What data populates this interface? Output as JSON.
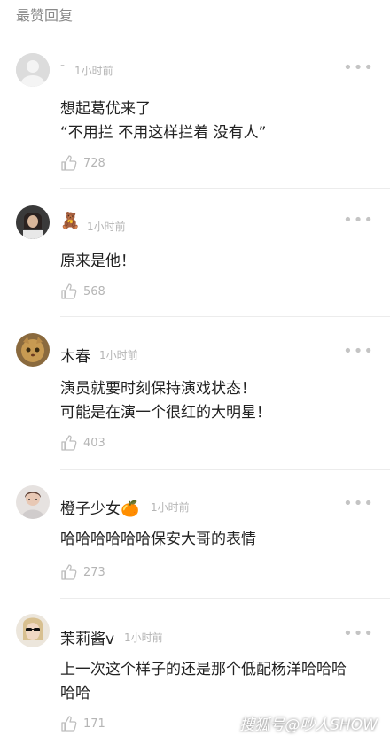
{
  "section_title": "最赞回复",
  "comments": [
    {
      "name": "-",
      "time": "1小时前",
      "lines": [
        "想起葛优来了",
        "“不用拦 不用这样拦着 没有人”"
      ],
      "likes": "728"
    },
    {
      "name": "🧸",
      "time": "1小时前",
      "lines": [
        "原来是他！"
      ],
      "likes": "568"
    },
    {
      "name": "木春",
      "time": "1小时前",
      "lines": [
        "演员就要时刻保持演戏状态！",
        "可能是在演一个很红的大明星！"
      ],
      "likes": "403"
    },
    {
      "name": "橙子少女🍊",
      "time": "1小时前",
      "lines": [
        "哈哈哈哈哈哈保安大哥的表情"
      ],
      "likes": "273"
    },
    {
      "name": "茉莉酱v",
      "time": "1小时前",
      "lines": [
        "上一次这个样子的还是那个低配杨洋哈哈哈",
        "哈哈"
      ],
      "likes": "171"
    }
  ],
  "more_label": "•••",
  "watermark": "搜狐号@吵人SHOW",
  "colors": {
    "muted": "#b5b5b5",
    "divider": "#ececec"
  }
}
